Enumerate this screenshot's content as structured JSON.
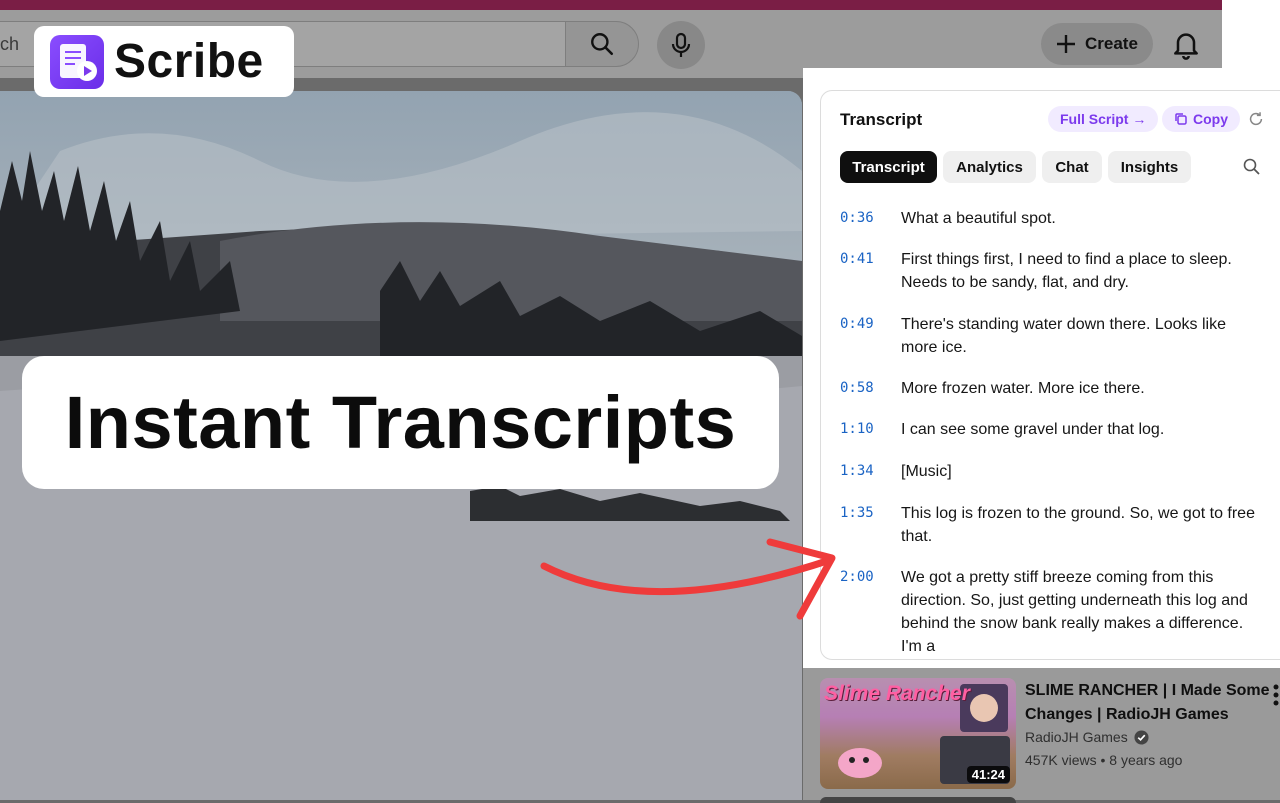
{
  "header": {
    "search_partial": "ch",
    "create_label": "Create"
  },
  "brand": {
    "name": "Scribe",
    "accent": "#7c3aed"
  },
  "headline": "Instant Transcripts",
  "transcript_panel": {
    "title": "Transcript",
    "full_script_label": "Full Script →",
    "copy_label": "Copy",
    "tabs": [
      "Transcript",
      "Analytics",
      "Chat",
      "Insights"
    ],
    "active_tab": "Transcript",
    "lines": [
      {
        "time": "0:36",
        "text": "What a beautiful spot."
      },
      {
        "time": "0:41",
        "text": "First things first, I need to find a place to sleep. Needs to be sandy, flat, and dry."
      },
      {
        "time": "0:49",
        "text": "There's standing water down there. Looks like more ice."
      },
      {
        "time": "0:58",
        "text": "More frozen water. More ice there."
      },
      {
        "time": "1:10",
        "text": "I can see some gravel under that log."
      },
      {
        "time": "1:34",
        "text": "[Music]"
      },
      {
        "time": "1:35",
        "text": "This log is frozen to the ground. So, we got to free that."
      },
      {
        "time": "2:00",
        "text": "We got a pretty stiff breeze coming from this direction. So, just getting underneath this log and behind the snow bank really makes a difference. I'm a"
      }
    ]
  },
  "recommendation": {
    "title": "SLIME RANCHER | I Made Some Changes | RadioJH Games",
    "channel": "RadioJH Games",
    "views": "457K views",
    "age": "8 years ago",
    "duration": "41:24",
    "thumb_text": "Slime Rancher"
  }
}
